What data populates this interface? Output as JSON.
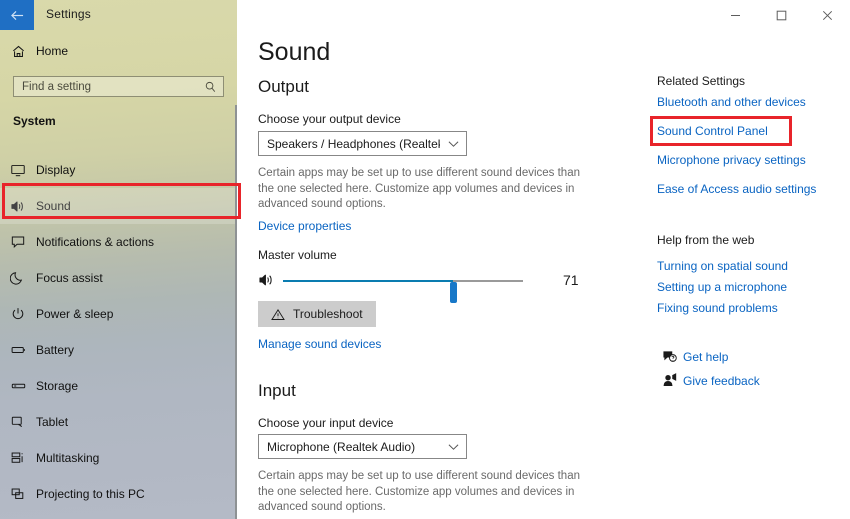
{
  "titlebar": {
    "back_icon": "back-arrow-icon",
    "title": "Settings",
    "minimize_label": "Minimize",
    "maximize_label": "Maximize",
    "close_label": "Close"
  },
  "sidebar": {
    "home_label": "Home",
    "home_icon": "home-icon",
    "search": {
      "placeholder": "Find a setting",
      "value": "",
      "icon": "search-icon"
    },
    "section_label": "System",
    "items": [
      {
        "label": "Display",
        "icon": "monitor-icon",
        "selected": false
      },
      {
        "label": "Sound",
        "icon": "speaker-icon",
        "selected": true
      },
      {
        "label": "Notifications & actions",
        "icon": "notification-icon",
        "selected": false
      },
      {
        "label": "Focus assist",
        "icon": "moon-icon",
        "selected": false
      },
      {
        "label": "Power & sleep",
        "icon": "power-icon",
        "selected": false
      },
      {
        "label": "Battery",
        "icon": "battery-icon",
        "selected": false
      },
      {
        "label": "Storage",
        "icon": "storage-icon",
        "selected": false
      },
      {
        "label": "Tablet",
        "icon": "tablet-icon",
        "selected": false
      },
      {
        "label": "Multitasking",
        "icon": "multitasking-icon",
        "selected": false
      },
      {
        "label": "Projecting to this PC",
        "icon": "projecting-icon",
        "selected": false
      }
    ]
  },
  "main": {
    "page_title": "Sound",
    "output": {
      "heading": "Output",
      "device_label": "Choose your output device",
      "device_value": "Speakers / Headphones (Realtek Au...",
      "description": "Certain apps may be set up to use different sound devices than the one selected here. Customize app volumes and devices in advanced sound options.",
      "device_properties_link": "Device properties",
      "master_volume_label": "Master volume",
      "volume_value": "71",
      "volume_percent": 71,
      "speaker_icon": "speaker-icon",
      "troubleshoot_label": "Troubleshoot",
      "troubleshoot_icon": "warning-triangle-icon",
      "manage_devices_link": "Manage sound devices"
    },
    "input": {
      "heading": "Input",
      "device_label": "Choose your input device",
      "device_value": "Microphone (Realtek Audio)",
      "description": "Certain apps may be set up to use different sound devices than the one selected here. Customize app volumes and devices in advanced sound options."
    }
  },
  "right_panel": {
    "related_settings_title": "Related Settings",
    "related_links": [
      "Bluetooth and other devices",
      "Sound Control Panel",
      "Microphone privacy settings",
      "Ease of Access audio settings"
    ],
    "help_title": "Help from the web",
    "help_links": [
      "Turning on spatial sound",
      "Setting up a microphone",
      "Fixing sound problems"
    ],
    "footer": [
      {
        "label": "Get help",
        "icon": "get-help-icon"
      },
      {
        "label": "Give feedback",
        "icon": "give-feedback-icon"
      }
    ]
  },
  "highlights": {
    "color": "#e8242a",
    "targets": [
      "sidebar-item-sound",
      "related-link-sound-control-panel"
    ]
  }
}
